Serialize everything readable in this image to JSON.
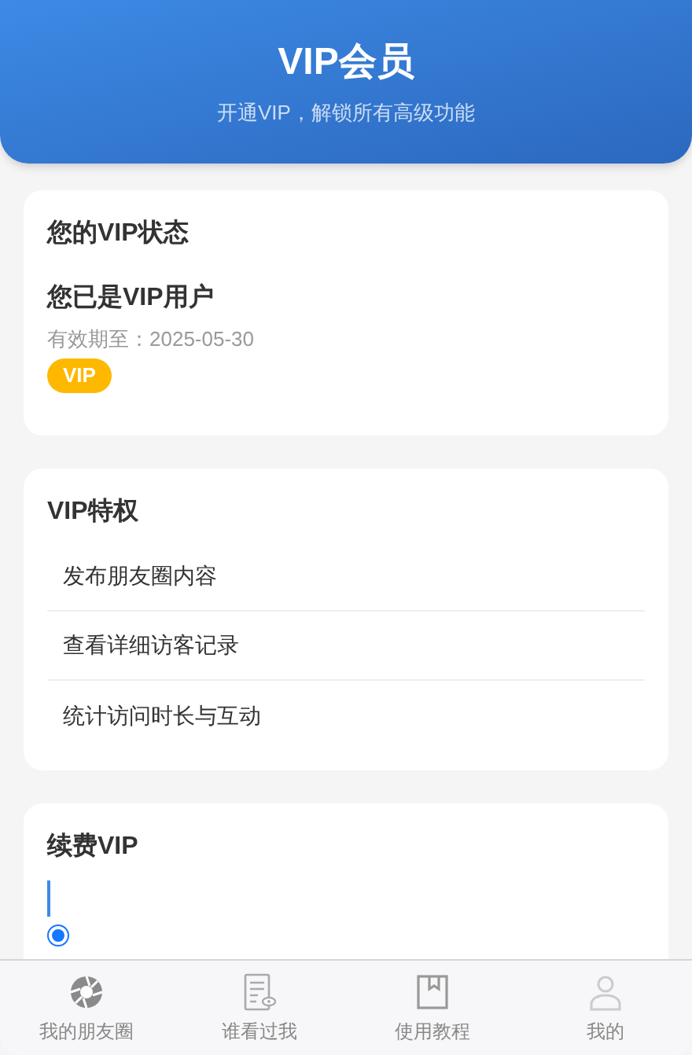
{
  "header": {
    "title": "VIP会员",
    "subtitle": "开通VIP，解锁所有高级功能"
  },
  "status_card": {
    "title": "您的VIP状态",
    "headline": "您已是VIP用户",
    "expiry": "有效期至：2025-05-30",
    "badge": "VIP"
  },
  "privileges": {
    "title": "VIP特权",
    "items": [
      "发布朋友圈内容",
      "查看详细访客记录",
      "统计访问时长与互动"
    ]
  },
  "renew": {
    "title": "续费VIP",
    "option": {
      "checked": true
    }
  },
  "tab_bar": [
    {
      "label": "我的朋友圈"
    },
    {
      "label": "谁看过我"
    },
    {
      "label": "使用教程"
    },
    {
      "label": "我的"
    }
  ]
}
